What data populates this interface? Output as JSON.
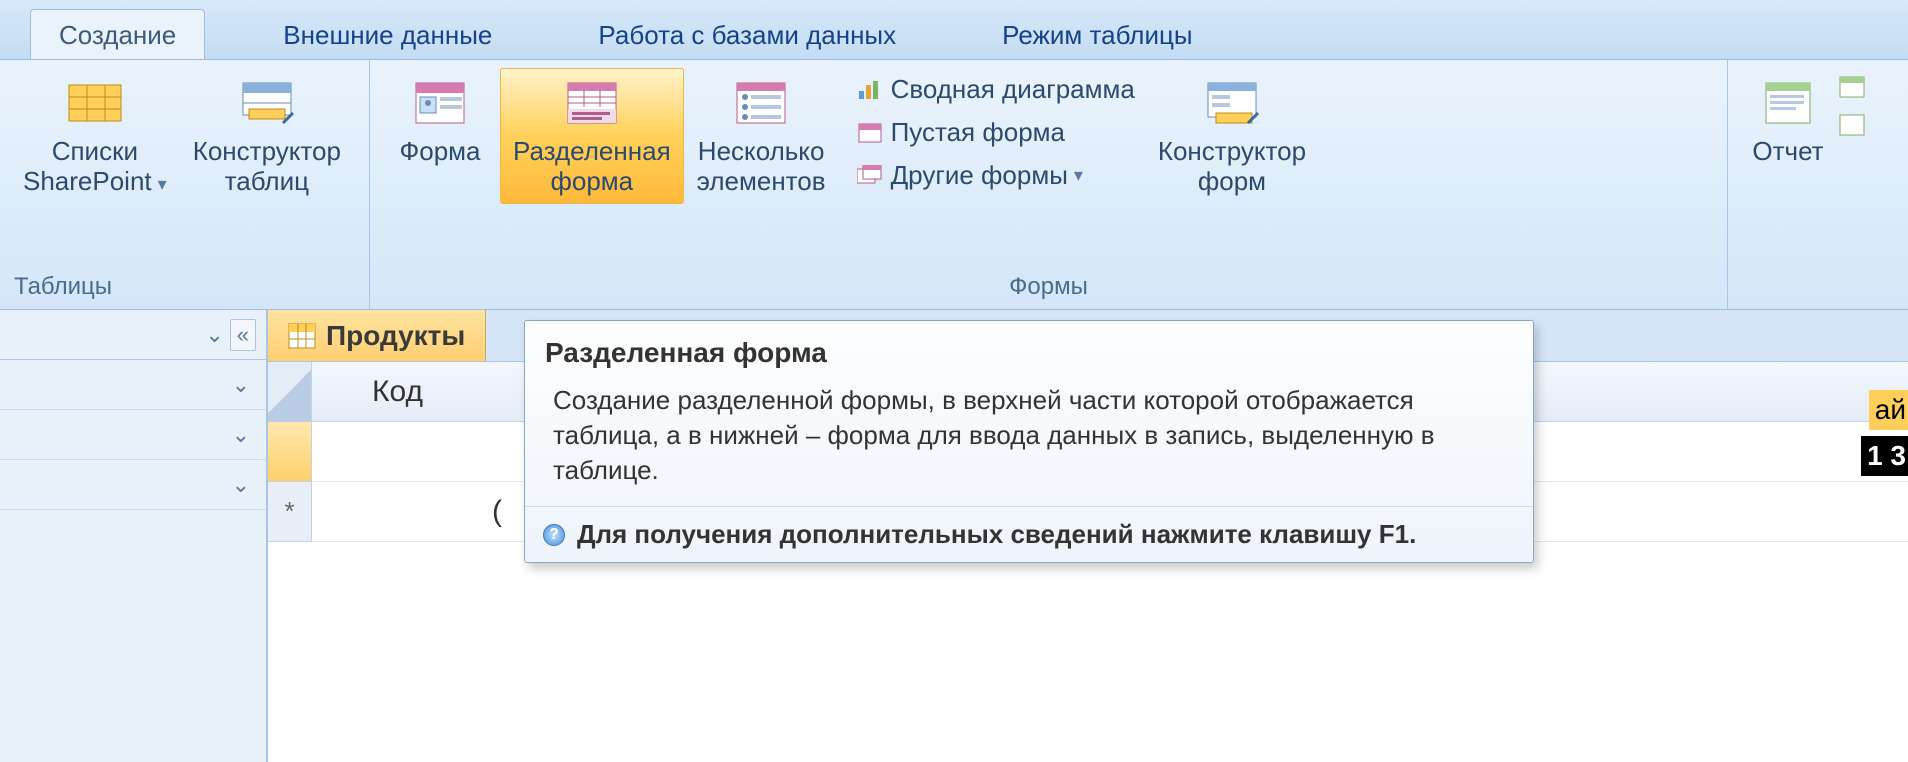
{
  "tabs": {
    "create": "Создание",
    "external": "Внешние данные",
    "database": "Работа с базами данных",
    "tablemode": "Режим таблицы"
  },
  "groups": {
    "tables": {
      "label": "Таблицы",
      "sharepoint": "Списки\nSharePoint",
      "designer": "Конструктор\nтаблиц"
    },
    "forms": {
      "label": "Формы",
      "form": "Форма",
      "split": "Разделенная\nформа",
      "multi": "Несколько\nэлементов",
      "pivotchart": "Сводная диаграмма",
      "blank": "Пустая форма",
      "other": "Другие формы",
      "designer": "Конструктор\nформ"
    },
    "reports": {
      "report": "Отчет"
    }
  },
  "nav": {
    "collapse": "«"
  },
  "doc": {
    "tab": "Продукты",
    "col1": "Код",
    "newrow": "(",
    "star": "*"
  },
  "tooltip": {
    "title": "Разделенная форма",
    "body": "Создание разделенной формы, в верхней части которой отображается таблица, а в нижней – форма для ввода данных в запись, выделенную в таблице.",
    "footer": "Для получения дополнительных сведений нажмите клавишу F1."
  },
  "partial": {
    "right1": "ай",
    "right2": "1 3"
  }
}
